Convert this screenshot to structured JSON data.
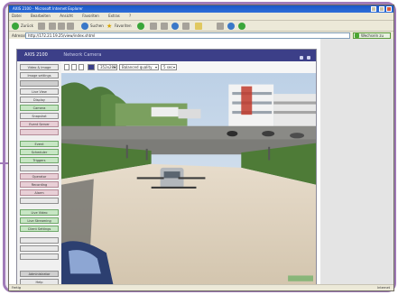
{
  "browser": {
    "title": "AXIS 2100 - Microsoft Internet Explorer",
    "menu": [
      "Datei",
      "Bearbeiten",
      "Ansicht",
      "Favoriten",
      "Extras",
      "?"
    ],
    "toolbar": {
      "back_label": "Zurück",
      "search_label": "Suchen",
      "favorites_label": "Favoriten"
    },
    "address": {
      "label": "Adresse",
      "url": "http://172.21.19.25/view/index.shtml",
      "go_label": "Wechseln zu"
    },
    "status": {
      "text": "Fertig",
      "zone": "Internet"
    }
  },
  "app": {
    "title": "AXIS 2100",
    "product": "Network Camera",
    "sidebar": [
      "Video & Image",
      "Image settings",
      "",
      "Live View",
      "Display",
      "Camera",
      "Snapshot",
      "Event Server",
      "",
      "Event",
      "Scheduler",
      "Triggers",
      "",
      "Operator",
      "Recording",
      "Alarm",
      "",
      "Live Video",
      "Live Streaming",
      "Client Settings",
      "",
      "",
      "",
      "Administrator",
      "Help"
    ],
    "controls": {
      "resolution": "352x288",
      "compression": "Balanced quality",
      "refresh": "5 sec"
    }
  },
  "colors": {
    "frame": "#a07ab8",
    "title_bar": "#1a56c8",
    "app_header": "#3c3f88",
    "sidebar_green": "#c7e6c4",
    "sidebar_pink": "#e8cfd6"
  }
}
